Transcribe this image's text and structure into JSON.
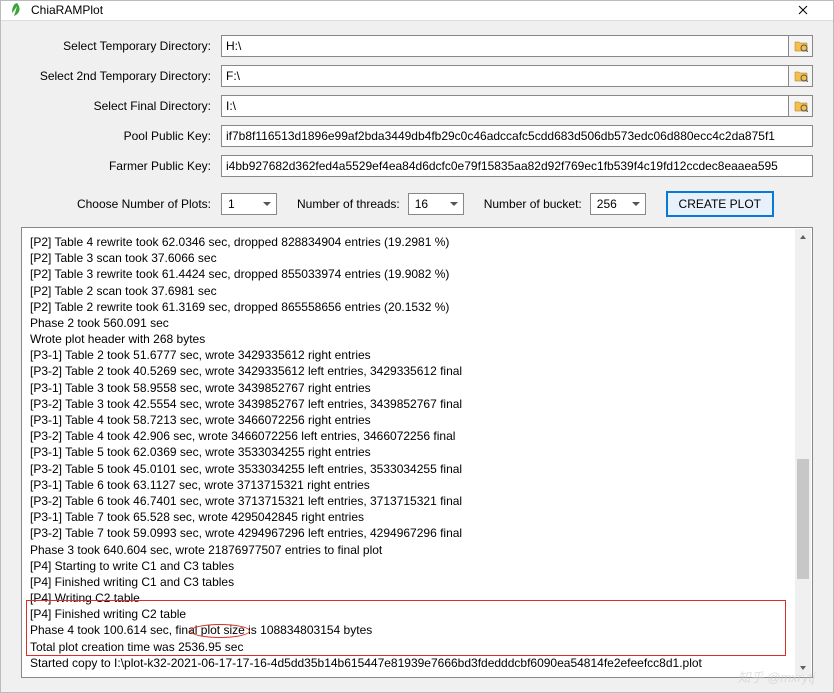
{
  "window": {
    "title": "ChiaRAMPlot"
  },
  "form": {
    "tempDir": {
      "label": "Select Temporary Directory:",
      "value": "H:\\"
    },
    "temp2Dir": {
      "label": "Select 2nd Temporary Directory:",
      "value": "F:\\"
    },
    "finalDir": {
      "label": "Select Final Directory:",
      "value": "I:\\"
    },
    "poolKey": {
      "label": "Pool Public Key:",
      "value": "if7b8f116513d1896e99af2bda3449db4fb29c0c46adccafc5cdd683d506db573edc06d880ecc4c2da875f1"
    },
    "farmerKey": {
      "label": "Farmer Public Key:",
      "value": "i4bb927682d362fed4a5529ef4ea84d6dcfc0e79f15835aa82d92f769ec1fb539f4c19fd12ccdec8eaaea595"
    },
    "numPlots": {
      "label": "Choose Number of Plots:",
      "value": "1"
    },
    "threads": {
      "label": "Number of threads:",
      "value": "16"
    },
    "buckets": {
      "label": "Number of bucket:",
      "value": "256"
    },
    "createBtn": "CREATE PLOT"
  },
  "log": [
    "[P2] Table 4 rewrite took 62.0346 sec, dropped 828834904 entries (19.2981 %)",
    "[P2] Table 3 scan took 37.6066 sec",
    "[P2] Table 3 rewrite took 61.4424 sec, dropped 855033974 entries (19.9082 %)",
    "[P2] Table 2 scan took 37.6981 sec",
    "[P2] Table 2 rewrite took 61.3169 sec, dropped 865558656 entries (20.1532 %)",
    "Phase 2 took 560.091 sec",
    "Wrote plot header with 268 bytes",
    "[P3-1] Table 2 took 51.6777 sec, wrote 3429335612 right entries",
    "[P3-2] Table 2 took 40.5269 sec, wrote 3429335612 left entries, 3429335612 final",
    "[P3-1] Table 3 took 58.9558 sec, wrote 3439852767 right entries",
    "[P3-2] Table 3 took 42.5554 sec, wrote 3439852767 left entries, 3439852767 final",
    "[P3-1] Table 4 took 58.7213 sec, wrote 3466072256 right entries",
    "[P3-2] Table 4 took 42.906 sec, wrote 3466072256 left entries, 3466072256 final",
    "[P3-1] Table 5 took 62.0369 sec, wrote 3533034255 right entries",
    "[P3-2] Table 5 took 45.0101 sec, wrote 3533034255 left entries, 3533034255 final",
    "[P3-1] Table 6 took 63.1127 sec, wrote 3713715321 right entries",
    "[P3-2] Table 6 took 46.7401 sec, wrote 3713715321 left entries, 3713715321 final",
    "[P3-1] Table 7 took 65.528 sec, wrote 4295042845 right entries",
    "[P3-2] Table 7 took 59.0993 sec, wrote 4294967296 left entries, 4294967296 final",
    "Phase 3 took 640.604 sec, wrote 21876977507 entries to final plot",
    "[P4] Starting to write C1 and C3 tables",
    "[P4] Finished writing C1 and C3 tables",
    "[P4] Writing C2 table",
    "[P4] Finished writing C2 table",
    "Phase 4 took 100.614 sec, final plot size is 108834803154 bytes",
    "Total plot creation time was 2536.95 sec",
    "Started copy to I:\\plot-k32-2021-06-17-17-16-4d5dd35b14b615447e81939e7666bd3fdedddcbf6090ea54814fe2efeefcc8d1.plot"
  ],
  "watermark": "知乎 @mxrytj"
}
